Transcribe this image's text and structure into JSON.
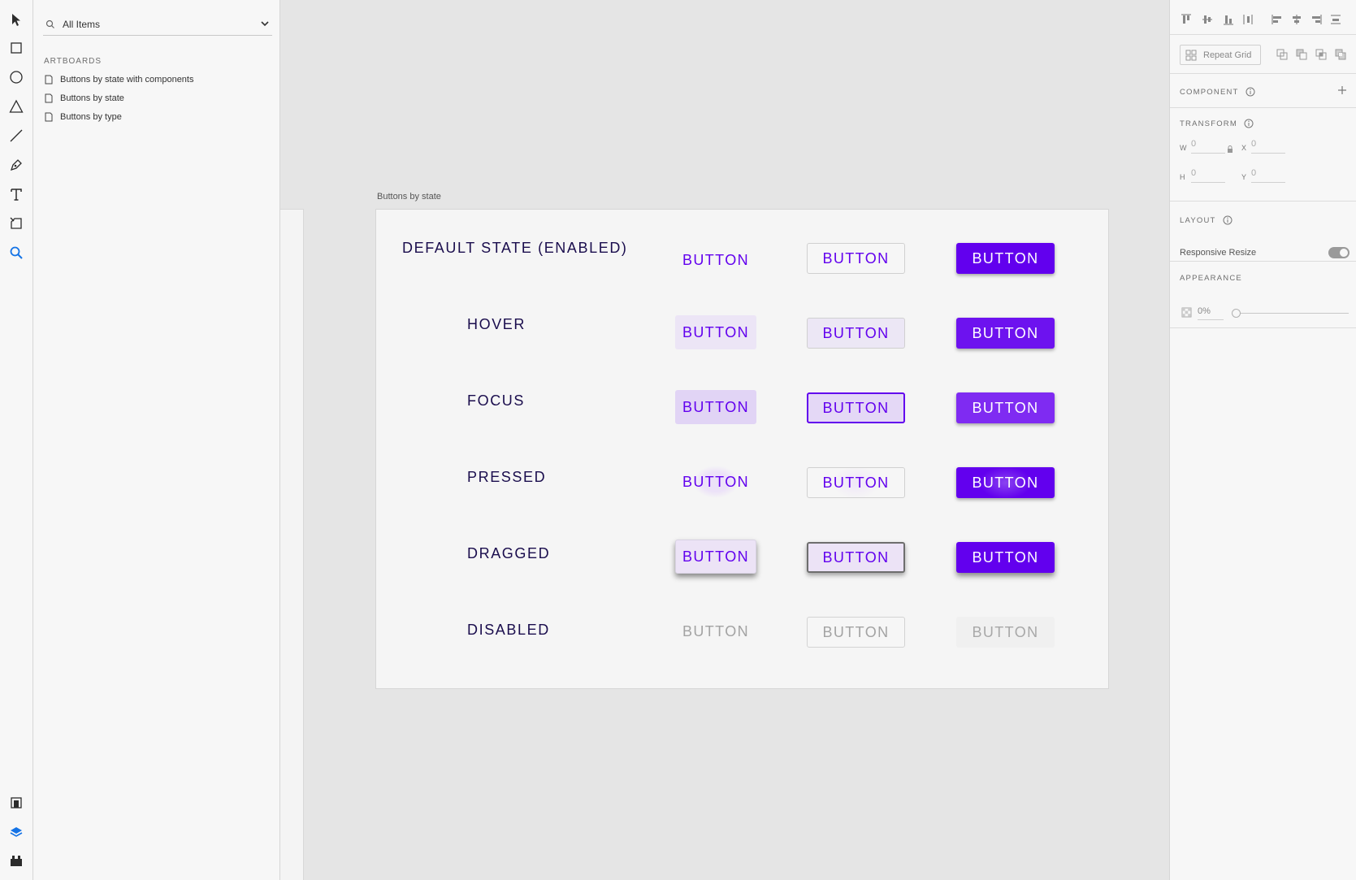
{
  "assets_panel": {
    "search_value": "All Items",
    "artboards_heading": "ARTBOARDS",
    "artboards": [
      {
        "label": "Buttons by state with components"
      },
      {
        "label": "Buttons by state"
      },
      {
        "label": "Buttons by type"
      }
    ]
  },
  "toolbar": {
    "tools": [
      "select-icon",
      "rectangle-icon",
      "ellipse-icon",
      "triangle-icon",
      "line-icon",
      "pen-icon",
      "text-icon",
      "artboard-icon",
      "zoom-icon"
    ],
    "bottom_tools": [
      "assets-icon",
      "layers-icon",
      "plugins-icon"
    ],
    "active_color": "#1473e6"
  },
  "canvas": {
    "artboard_label": "Buttons by state",
    "states": [
      {
        "label": "DEFAULT STATE (ENABLED)"
      },
      {
        "label": "HOVER"
      },
      {
        "label": "FOCUS"
      },
      {
        "label": "PRESSED"
      },
      {
        "label": "DRAGGED"
      },
      {
        "label": "DISABLED"
      }
    ],
    "button_label": "BUTTON",
    "colors": {
      "primary": "#6200ee",
      "label": "#1a0d4d",
      "disabled": "#a3a3a3"
    }
  },
  "inspector": {
    "repeat_grid_label": "Repeat Grid",
    "component_heading": "COMPONENT",
    "transform_heading": "TRANSFORM",
    "w_label": "W",
    "w_value": "0",
    "h_label": "H",
    "h_value": "0",
    "x_label": "X",
    "x_value": "0",
    "y_label": "Y",
    "y_value": "0",
    "layout_heading": "LAYOUT",
    "responsive_resize_label": "Responsive Resize",
    "responsive_resize_on": true,
    "appearance_heading": "APPEARANCE",
    "opacity_value": "0%"
  }
}
